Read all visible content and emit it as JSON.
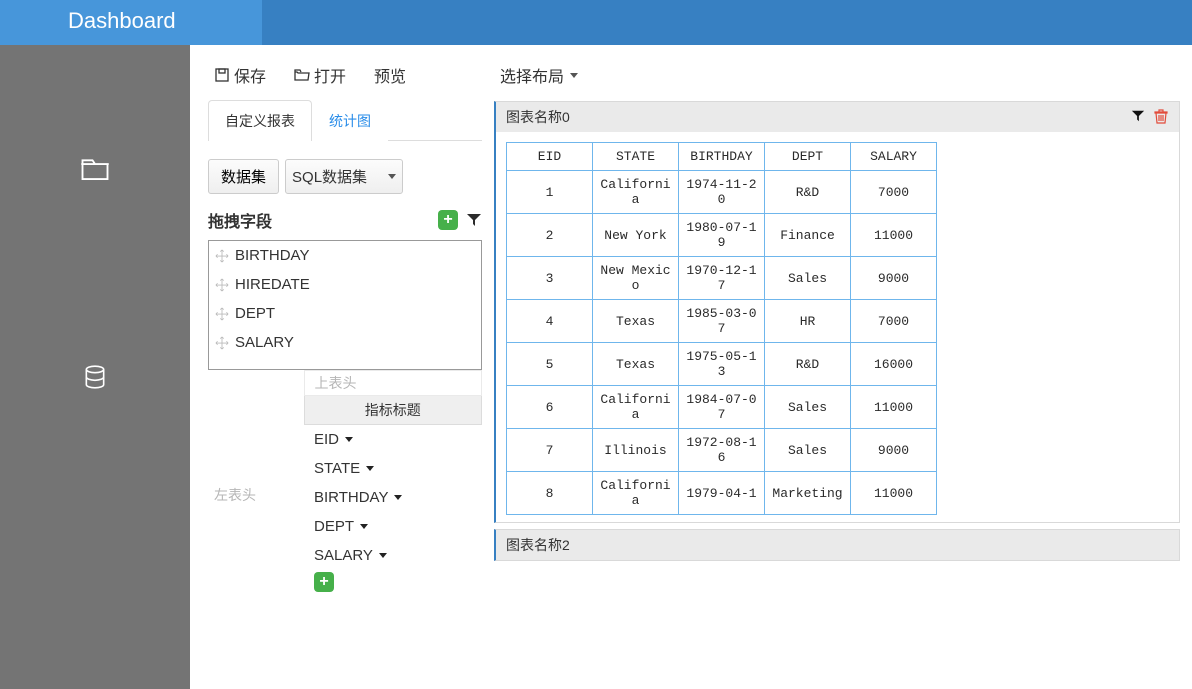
{
  "header": {
    "brand": "Dashboard"
  },
  "toolbar": {
    "save": "保存",
    "open": "打开",
    "preview": "预览"
  },
  "tabs": {
    "custom_report": "自定义报表",
    "chart": "统计图"
  },
  "dataset": {
    "btn": "数据集",
    "select": "SQL数据集"
  },
  "drag": {
    "title": "拖拽字段"
  },
  "fields": [
    "BIRTHDAY",
    "HIREDATE",
    "DEPT",
    "SALARY"
  ],
  "struct": {
    "top_header": "上表头",
    "metric_title": "指标标题",
    "left_header": "左表头",
    "columns": [
      "EID",
      "STATE",
      "BIRTHDAY",
      "DEPT",
      "SALARY"
    ]
  },
  "main": {
    "layout": "选择布局",
    "chart0": "图表名称0",
    "chart2": "图表名称2"
  },
  "table": {
    "headers": [
      "EID",
      "STATE",
      "BIRTHDAY",
      "DEPT",
      "SALARY"
    ],
    "rows": [
      [
        "1",
        "California",
        "1974-11-20",
        "R&D",
        "7000"
      ],
      [
        "2",
        "New York",
        "1980-07-19",
        "Finance",
        "11000"
      ],
      [
        "3",
        "New Mexico",
        "1970-12-17",
        "Sales",
        "9000"
      ],
      [
        "4",
        "Texas",
        "1985-03-07",
        "HR",
        "7000"
      ],
      [
        "5",
        "Texas",
        "1975-05-13",
        "R&D",
        "16000"
      ],
      [
        "6",
        "California",
        "1984-07-07",
        "Sales",
        "11000"
      ],
      [
        "7",
        "Illinois",
        "1972-08-16",
        "Sales",
        "9000"
      ],
      [
        "8",
        "California",
        "1979-04-1",
        "Marketing",
        "11000"
      ]
    ]
  }
}
